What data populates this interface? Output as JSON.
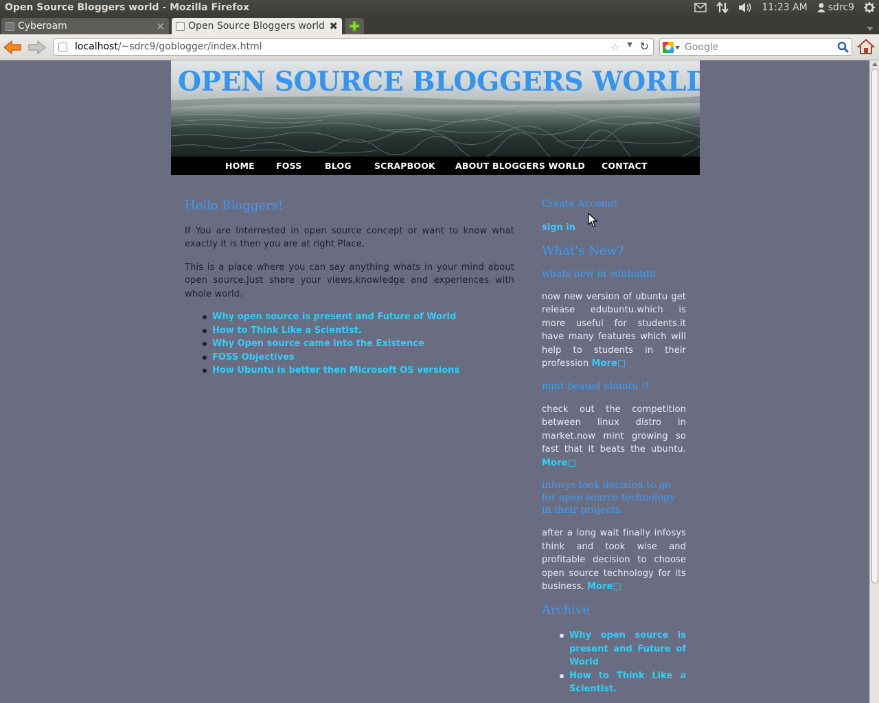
{
  "os_panel": {
    "window_title": "Open Source Bloggers world - Mozilla Firefox",
    "time": "11:23 AM",
    "user": "sdrc9",
    "icons": [
      "mail-icon",
      "network-icon",
      "volume-icon",
      "user-icon",
      "power-icon"
    ]
  },
  "browser": {
    "tabs": [
      {
        "label": "Cyberoam",
        "active": false
      },
      {
        "label": "Open Source Bloggers world",
        "active": true
      }
    ],
    "url_host": "localhost",
    "url_path": "/~sdrc9/goblogger/index.html",
    "search_placeholder": "Google"
  },
  "site": {
    "title": "OPEN SOURCE BLOGGERS WORLD !",
    "nav": [
      "HOME",
      "FOSS",
      "BLOG",
      "SCRAPBOOK",
      "ABOUT BLOGGERS WORLD",
      "CONTACT"
    ],
    "main": {
      "heading": "Hello Bloggers!",
      "para1": "If You are Interrested in open source concept or want to know what exactly it is then you are at right Place.",
      "para2": "This is a place where you can say anything whats in your mind about open source.Just share your views,knowledge and experiences with whole world.",
      "articles": [
        "Why open source is present and Future of World",
        "How to Think Like a Scientist.",
        "Why Open source came into the Existence",
        "FOSS Objectives",
        "How Ubuntu is better then Microsoft OS versions"
      ]
    },
    "sidebar": {
      "create_account": "Create Account",
      "sign_in": "sign in",
      "whats_new_heading": "What's New?",
      "news": [
        {
          "title": "whats new in edubuntu",
          "body": "now new version of ubuntu get release edubuntu.which is more useful for students.it have many features which will help to students in their profession",
          "more": "More□"
        },
        {
          "title": "mint beated ubuntu !!",
          "body": "check out the competition between linux distro in market.now mint growing so fast that it beats the ubuntu.",
          "more": "More□"
        },
        {
          "title": "infosys took decision to go for open source technology in their projects.",
          "body": "after a long wait finally infosys think and took wise and profitable decision to choose open source technology for its business.",
          "more": "More□"
        }
      ],
      "archive_heading": "Archive",
      "archive": [
        "Why open source is present and Future of World",
        "How to Think Like a Scientist."
      ]
    }
  },
  "colors": {
    "page_bg": "#6a6c82",
    "title_blue": "#3594ee",
    "link_cyan": "#2fd0f8",
    "nav_bg": "#000000"
  }
}
